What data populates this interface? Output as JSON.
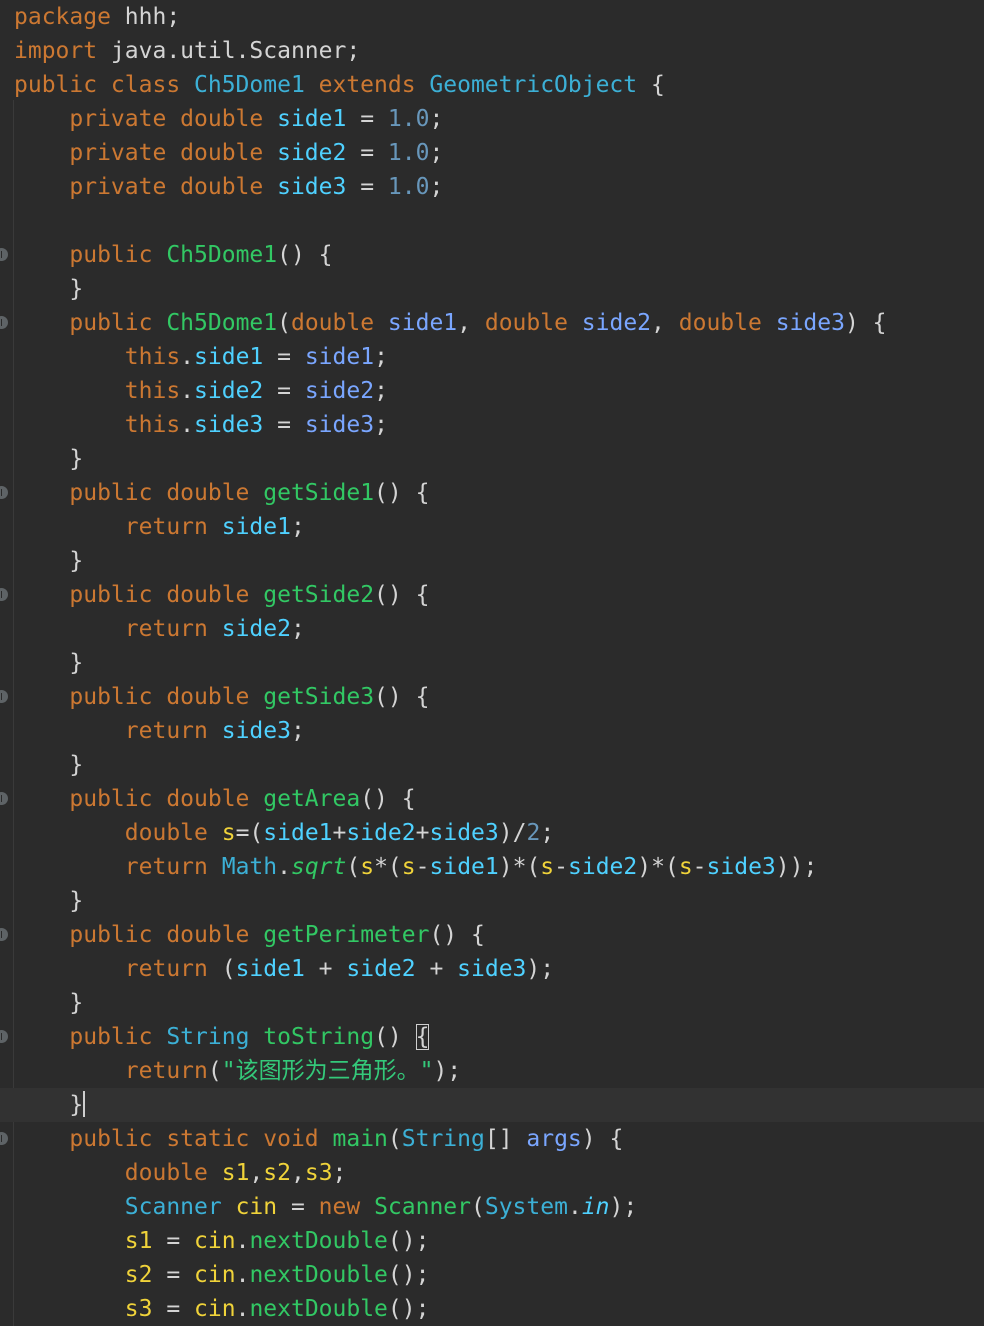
{
  "editor": {
    "colors": {
      "background": "#2b2b2b",
      "current_line": "#323232",
      "keyword": "#cc7832",
      "class_name": "#3cb0d6",
      "field": "#4fd1ff",
      "parameter": "#7aa6ff",
      "method": "#32c864",
      "number": "#6897bb",
      "string": "#34c97a",
      "plain": "#d4d4d4",
      "local_var": "#f0d33a"
    },
    "lines": [
      [
        {
          "t": "package",
          "c": "#cc7832"
        },
        {
          "t": " hhh;",
          "c": "#d4d4d4"
        }
      ],
      [
        {
          "t": "import",
          "c": "#cc7832"
        },
        {
          "t": " java.util.Scanner;",
          "c": "#d4d4d4"
        }
      ],
      [
        {
          "t": "public class ",
          "c": "#cc7832"
        },
        {
          "t": "Ch5Dome1",
          "c": "#3cb0d6"
        },
        {
          "t": " extends ",
          "c": "#cc7832"
        },
        {
          "t": "GeometricObject",
          "c": "#3cb0d6"
        },
        {
          "t": " {",
          "c": "#d4d4d4"
        }
      ],
      [
        {
          "t": "    "
        },
        {
          "t": "private double ",
          "c": "#cc7832"
        },
        {
          "t": "side1",
          "c": "#4fd1ff"
        },
        {
          "t": " = ",
          "c": "#d4d4d4"
        },
        {
          "t": "1.0",
          "c": "#6897bb"
        },
        {
          "t": ";",
          "c": "#d4d4d4"
        }
      ],
      [
        {
          "t": "    "
        },
        {
          "t": "private double ",
          "c": "#cc7832"
        },
        {
          "t": "side2",
          "c": "#4fd1ff"
        },
        {
          "t": " = ",
          "c": "#d4d4d4"
        },
        {
          "t": "1.0",
          "c": "#6897bb"
        },
        {
          "t": ";",
          "c": "#d4d4d4"
        }
      ],
      [
        {
          "t": "    "
        },
        {
          "t": "private double ",
          "c": "#cc7832"
        },
        {
          "t": "side3",
          "c": "#4fd1ff"
        },
        {
          "t": " = ",
          "c": "#d4d4d4"
        },
        {
          "t": "1.0",
          "c": "#6897bb"
        },
        {
          "t": ";",
          "c": "#d4d4d4"
        }
      ],
      [],
      [
        {
          "t": "    "
        },
        {
          "t": "public ",
          "c": "#cc7832"
        },
        {
          "t": "Ch5Dome1",
          "c": "#32c864"
        },
        {
          "t": "() {",
          "c": "#d4d4d4"
        }
      ],
      [
        {
          "t": "    }",
          "c": "#d4d4d4"
        }
      ],
      [
        {
          "t": "    "
        },
        {
          "t": "public ",
          "c": "#cc7832"
        },
        {
          "t": "Ch5Dome1",
          "c": "#32c864"
        },
        {
          "t": "(",
          "c": "#d4d4d4"
        },
        {
          "t": "double ",
          "c": "#cc7832"
        },
        {
          "t": "side1",
          "c": "#7aa6ff"
        },
        {
          "t": ", ",
          "c": "#d4d4d4"
        },
        {
          "t": "double ",
          "c": "#cc7832"
        },
        {
          "t": "side2",
          "c": "#7aa6ff"
        },
        {
          "t": ", ",
          "c": "#d4d4d4"
        },
        {
          "t": "double ",
          "c": "#cc7832"
        },
        {
          "t": "side3",
          "c": "#7aa6ff"
        },
        {
          "t": ") {",
          "c": "#d4d4d4"
        }
      ],
      [
        {
          "t": "        "
        },
        {
          "t": "this",
          "c": "#cc7832"
        },
        {
          "t": ".",
          "c": "#d4d4d4"
        },
        {
          "t": "side1",
          "c": "#4fd1ff"
        },
        {
          "t": " = ",
          "c": "#d4d4d4"
        },
        {
          "t": "side1",
          "c": "#7aa6ff"
        },
        {
          "t": ";",
          "c": "#d4d4d4"
        }
      ],
      [
        {
          "t": "        "
        },
        {
          "t": "this",
          "c": "#cc7832"
        },
        {
          "t": ".",
          "c": "#d4d4d4"
        },
        {
          "t": "side2",
          "c": "#4fd1ff"
        },
        {
          "t": " = ",
          "c": "#d4d4d4"
        },
        {
          "t": "side2",
          "c": "#7aa6ff"
        },
        {
          "t": ";",
          "c": "#d4d4d4"
        }
      ],
      [
        {
          "t": "        "
        },
        {
          "t": "this",
          "c": "#cc7832"
        },
        {
          "t": ".",
          "c": "#d4d4d4"
        },
        {
          "t": "side3",
          "c": "#4fd1ff"
        },
        {
          "t": " = ",
          "c": "#d4d4d4"
        },
        {
          "t": "side3",
          "c": "#7aa6ff"
        },
        {
          "t": ";",
          "c": "#d4d4d4"
        }
      ],
      [
        {
          "t": "    }",
          "c": "#d4d4d4"
        }
      ],
      [
        {
          "t": "    "
        },
        {
          "t": "public double ",
          "c": "#cc7832"
        },
        {
          "t": "getSide1",
          "c": "#32c864"
        },
        {
          "t": "() {",
          "c": "#d4d4d4"
        }
      ],
      [
        {
          "t": "        "
        },
        {
          "t": "return ",
          "c": "#cc7832"
        },
        {
          "t": "side1",
          "c": "#4fd1ff"
        },
        {
          "t": ";",
          "c": "#d4d4d4"
        }
      ],
      [
        {
          "t": "    }",
          "c": "#d4d4d4"
        }
      ],
      [
        {
          "t": "    "
        },
        {
          "t": "public double ",
          "c": "#cc7832"
        },
        {
          "t": "getSide2",
          "c": "#32c864"
        },
        {
          "t": "() {",
          "c": "#d4d4d4"
        }
      ],
      [
        {
          "t": "        "
        },
        {
          "t": "return ",
          "c": "#cc7832"
        },
        {
          "t": "side2",
          "c": "#4fd1ff"
        },
        {
          "t": ";",
          "c": "#d4d4d4"
        }
      ],
      [
        {
          "t": "    }",
          "c": "#d4d4d4"
        }
      ],
      [
        {
          "t": "    "
        },
        {
          "t": "public double ",
          "c": "#cc7832"
        },
        {
          "t": "getSide3",
          "c": "#32c864"
        },
        {
          "t": "() {",
          "c": "#d4d4d4"
        }
      ],
      [
        {
          "t": "        "
        },
        {
          "t": "return ",
          "c": "#cc7832"
        },
        {
          "t": "side3",
          "c": "#4fd1ff"
        },
        {
          "t": ";",
          "c": "#d4d4d4"
        }
      ],
      [
        {
          "t": "    }",
          "c": "#d4d4d4"
        }
      ],
      [
        {
          "t": "    "
        },
        {
          "t": "public double ",
          "c": "#cc7832"
        },
        {
          "t": "getArea",
          "c": "#32c864"
        },
        {
          "t": "() {",
          "c": "#d4d4d4"
        }
      ],
      [
        {
          "t": "        "
        },
        {
          "t": "double ",
          "c": "#cc7832"
        },
        {
          "t": "s",
          "c": "#f0d33a"
        },
        {
          "t": "=(",
          "c": "#d4d4d4"
        },
        {
          "t": "side1",
          "c": "#4fd1ff"
        },
        {
          "t": "+",
          "c": "#d4d4d4"
        },
        {
          "t": "side2",
          "c": "#4fd1ff"
        },
        {
          "t": "+",
          "c": "#d4d4d4"
        },
        {
          "t": "side3",
          "c": "#4fd1ff"
        },
        {
          "t": ")/",
          "c": "#d4d4d4"
        },
        {
          "t": "2",
          "c": "#6897bb"
        },
        {
          "t": ";",
          "c": "#d4d4d4"
        }
      ],
      [
        {
          "t": "        "
        },
        {
          "t": "return ",
          "c": "#cc7832"
        },
        {
          "t": "Math",
          "c": "#3cb0d6"
        },
        {
          "t": ".",
          "c": "#d4d4d4"
        },
        {
          "t": "sqrt",
          "c": "#32c864",
          "i": true
        },
        {
          "t": "(",
          "c": "#d4d4d4"
        },
        {
          "t": "s",
          "c": "#f0d33a"
        },
        {
          "t": "*(",
          "c": "#d4d4d4"
        },
        {
          "t": "s",
          "c": "#f0d33a"
        },
        {
          "t": "-",
          "c": "#d4d4d4"
        },
        {
          "t": "side1",
          "c": "#4fd1ff"
        },
        {
          "t": ")*(",
          "c": "#d4d4d4"
        },
        {
          "t": "s",
          "c": "#f0d33a"
        },
        {
          "t": "-",
          "c": "#d4d4d4"
        },
        {
          "t": "side2",
          "c": "#4fd1ff"
        },
        {
          "t": ")*(",
          "c": "#d4d4d4"
        },
        {
          "t": "s",
          "c": "#f0d33a"
        },
        {
          "t": "-",
          "c": "#d4d4d4"
        },
        {
          "t": "side3",
          "c": "#4fd1ff"
        },
        {
          "t": "));",
          "c": "#d4d4d4"
        }
      ],
      [
        {
          "t": "    }",
          "c": "#d4d4d4"
        }
      ],
      [
        {
          "t": "    "
        },
        {
          "t": "public double ",
          "c": "#cc7832"
        },
        {
          "t": "getPerimeter",
          "c": "#32c864"
        },
        {
          "t": "() {",
          "c": "#d4d4d4"
        }
      ],
      [
        {
          "t": "        "
        },
        {
          "t": "return ",
          "c": "#cc7832"
        },
        {
          "t": "(",
          "c": "#d4d4d4"
        },
        {
          "t": "side1",
          "c": "#4fd1ff"
        },
        {
          "t": " + ",
          "c": "#d4d4d4"
        },
        {
          "t": "side2",
          "c": "#4fd1ff"
        },
        {
          "t": " + ",
          "c": "#d4d4d4"
        },
        {
          "t": "side3",
          "c": "#4fd1ff"
        },
        {
          "t": ");",
          "c": "#d4d4d4"
        }
      ],
      [
        {
          "t": "    }",
          "c": "#d4d4d4"
        }
      ],
      [
        {
          "t": "    "
        },
        {
          "t": "public ",
          "c": "#cc7832"
        },
        {
          "t": "String",
          "c": "#3cb0d6"
        },
        {
          "t": " ",
          "c": "#d4d4d4"
        },
        {
          "t": "toString",
          "c": "#32c864"
        },
        {
          "t": "() ",
          "c": "#d4d4d4"
        },
        {
          "t": "{",
          "c": "#d4d4d4",
          "b": true
        }
      ],
      [
        {
          "t": "        "
        },
        {
          "t": "return",
          "c": "#cc7832"
        },
        {
          "t": "(",
          "c": "#d4d4d4"
        },
        {
          "t": "\"该图形为三角形。\"",
          "c": "#34c97a"
        },
        {
          "t": ");",
          "c": "#d4d4d4"
        }
      ],
      [
        {
          "t": "    }",
          "c": "#d4d4d4"
        },
        {
          "caret": true
        }
      ],
      [
        {
          "t": "    "
        },
        {
          "t": "public static void ",
          "c": "#cc7832"
        },
        {
          "t": "main",
          "c": "#32c864"
        },
        {
          "t": "(",
          "c": "#d4d4d4"
        },
        {
          "t": "String",
          "c": "#3cb0d6"
        },
        {
          "t": "[] ",
          "c": "#d4d4d4"
        },
        {
          "t": "args",
          "c": "#7aa6ff"
        },
        {
          "t": ") {",
          "c": "#d4d4d4"
        }
      ],
      [
        {
          "t": "        "
        },
        {
          "t": "double ",
          "c": "#cc7832"
        },
        {
          "t": "s1",
          "c": "#f0d33a"
        },
        {
          "t": ",",
          "c": "#d4d4d4"
        },
        {
          "t": "s2",
          "c": "#f0d33a"
        },
        {
          "t": ",",
          "c": "#d4d4d4"
        },
        {
          "t": "s3",
          "c": "#f0d33a"
        },
        {
          "t": ";",
          "c": "#d4d4d4"
        }
      ],
      [
        {
          "t": "        "
        },
        {
          "t": "Scanner",
          "c": "#3cb0d6"
        },
        {
          "t": " ",
          "c": "#d4d4d4"
        },
        {
          "t": "cin",
          "c": "#f0d33a"
        },
        {
          "t": " = ",
          "c": "#d4d4d4"
        },
        {
          "t": "new ",
          "c": "#cc7832"
        },
        {
          "t": "Scanner",
          "c": "#32c864"
        },
        {
          "t": "(",
          "c": "#d4d4d4"
        },
        {
          "t": "System",
          "c": "#3cb0d6"
        },
        {
          "t": ".",
          "c": "#d4d4d4"
        },
        {
          "t": "in",
          "c": "#4fd1ff",
          "i": true
        },
        {
          "t": ");",
          "c": "#d4d4d4"
        }
      ],
      [
        {
          "t": "        "
        },
        {
          "t": "s1",
          "c": "#f0d33a"
        },
        {
          "t": " = ",
          "c": "#d4d4d4"
        },
        {
          "t": "cin",
          "c": "#f0d33a"
        },
        {
          "t": ".",
          "c": "#d4d4d4"
        },
        {
          "t": "nextDouble",
          "c": "#32c864"
        },
        {
          "t": "();",
          "c": "#d4d4d4"
        }
      ],
      [
        {
          "t": "        "
        },
        {
          "t": "s2",
          "c": "#f0d33a"
        },
        {
          "t": " = ",
          "c": "#d4d4d4"
        },
        {
          "t": "cin",
          "c": "#f0d33a"
        },
        {
          "t": ".",
          "c": "#d4d4d4"
        },
        {
          "t": "nextDouble",
          "c": "#32c864"
        },
        {
          "t": "();",
          "c": "#d4d4d4"
        }
      ],
      [
        {
          "t": "        "
        },
        {
          "t": "s3",
          "c": "#f0d33a"
        },
        {
          "t": " = ",
          "c": "#d4d4d4"
        },
        {
          "t": "cin",
          "c": "#f0d33a"
        },
        {
          "t": ".",
          "c": "#d4d4d4"
        },
        {
          "t": "nextDouble",
          "c": "#32c864"
        },
        {
          "t": "();",
          "c": "#d4d4d4"
        }
      ]
    ],
    "fold_marker_lines": [
      7,
      9,
      14,
      17,
      20,
      23,
      27,
      30,
      33
    ],
    "current_line": 32
  }
}
